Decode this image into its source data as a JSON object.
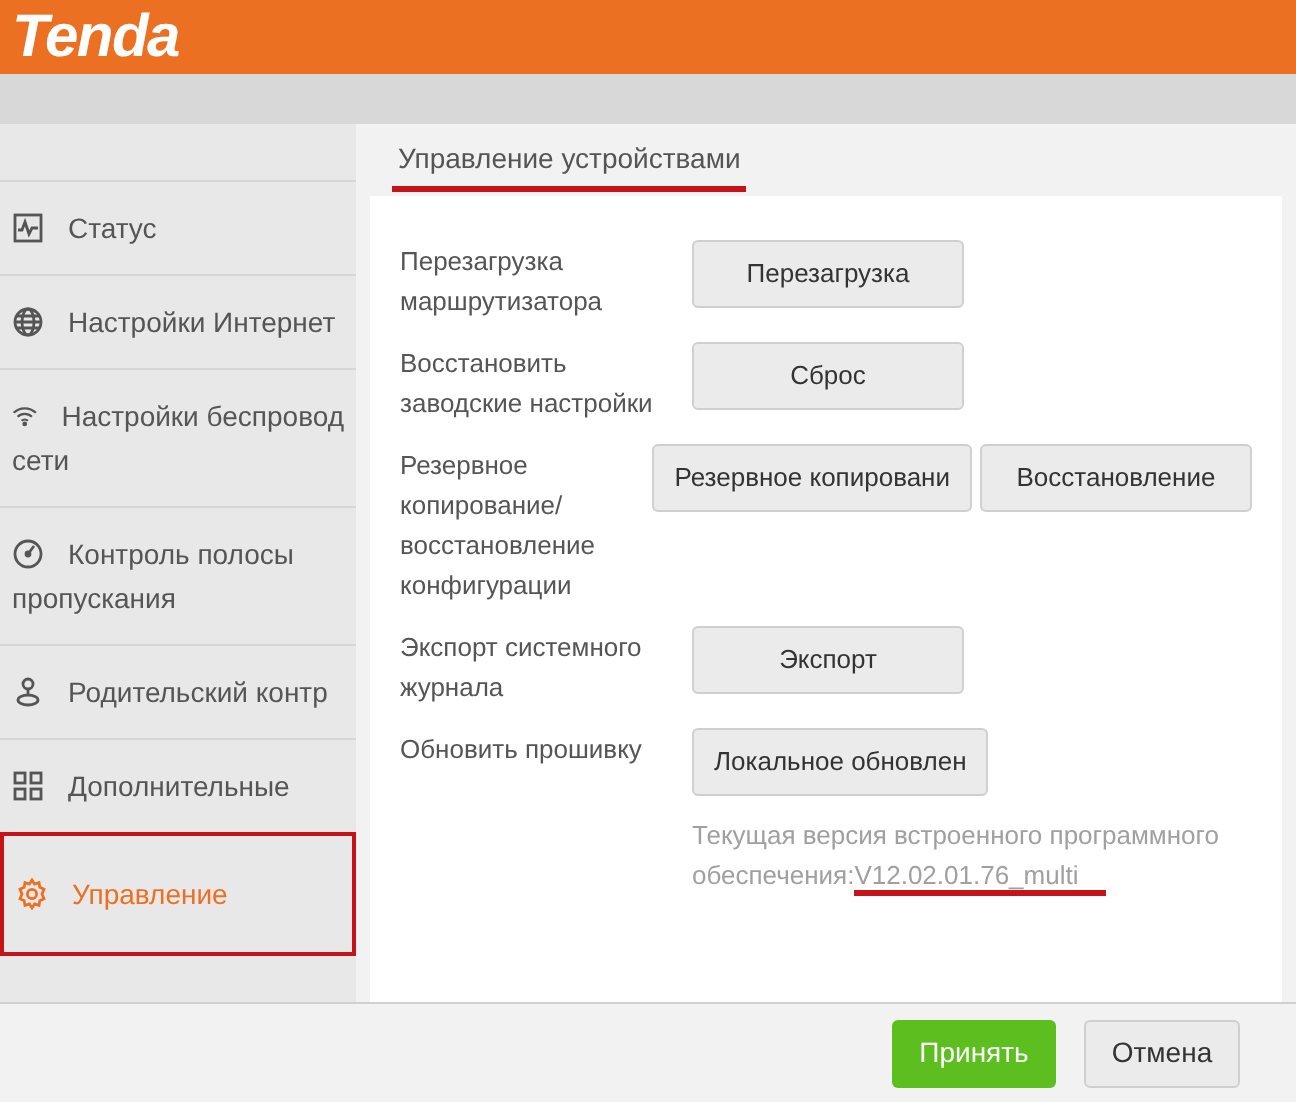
{
  "header": {
    "logo": "Tenda"
  },
  "sidebar": {
    "items": [
      {
        "kind": "status",
        "lines": [
          "Статус"
        ],
        "selected": false
      },
      {
        "kind": "globe",
        "lines": [
          "Настройки Интернет"
        ],
        "selected": false
      },
      {
        "kind": "wifi",
        "lines": [
          "Настройки беспровод",
          "сети"
        ],
        "selected": false
      },
      {
        "kind": "gauge",
        "lines": [
          "Контроль полосы",
          "пропускания"
        ],
        "selected": false
      },
      {
        "kind": "parent",
        "lines": [
          "Родительский контр"
        ],
        "selected": false
      },
      {
        "kind": "grid",
        "lines": [
          "Дополнительные"
        ],
        "selected": false
      },
      {
        "kind": "gear",
        "lines": [
          "Управление"
        ],
        "selected": true
      }
    ]
  },
  "section_title": "Управление устройствами",
  "rows": [
    {
      "label": "Перезагрузка маршрутизатора",
      "buttons": [
        "Перезагрузка"
      ]
    },
    {
      "label": "Восстановить заводские настройки",
      "buttons": [
        "Сброс"
      ]
    },
    {
      "label": "Резервное копирование/ восстановление конфигурации",
      "buttons": [
        "Резервное копировани",
        "Восстановление"
      ]
    },
    {
      "label": "Экспорт системного журнала",
      "buttons": [
        "Экспорт"
      ]
    },
    {
      "label": "Обновить прошивку",
      "buttons": [
        "Локальное обновлен"
      ]
    }
  ],
  "firmware_note": {
    "text": "Текущая версия встроенного программного обеспечения:",
    "version": "V12.02.01.76_multi"
  },
  "footer": {
    "buttons": [
      {
        "label": "Принять",
        "kind": "primary"
      },
      {
        "label": "Отмена",
        "kind": "secondary"
      }
    ]
  }
}
